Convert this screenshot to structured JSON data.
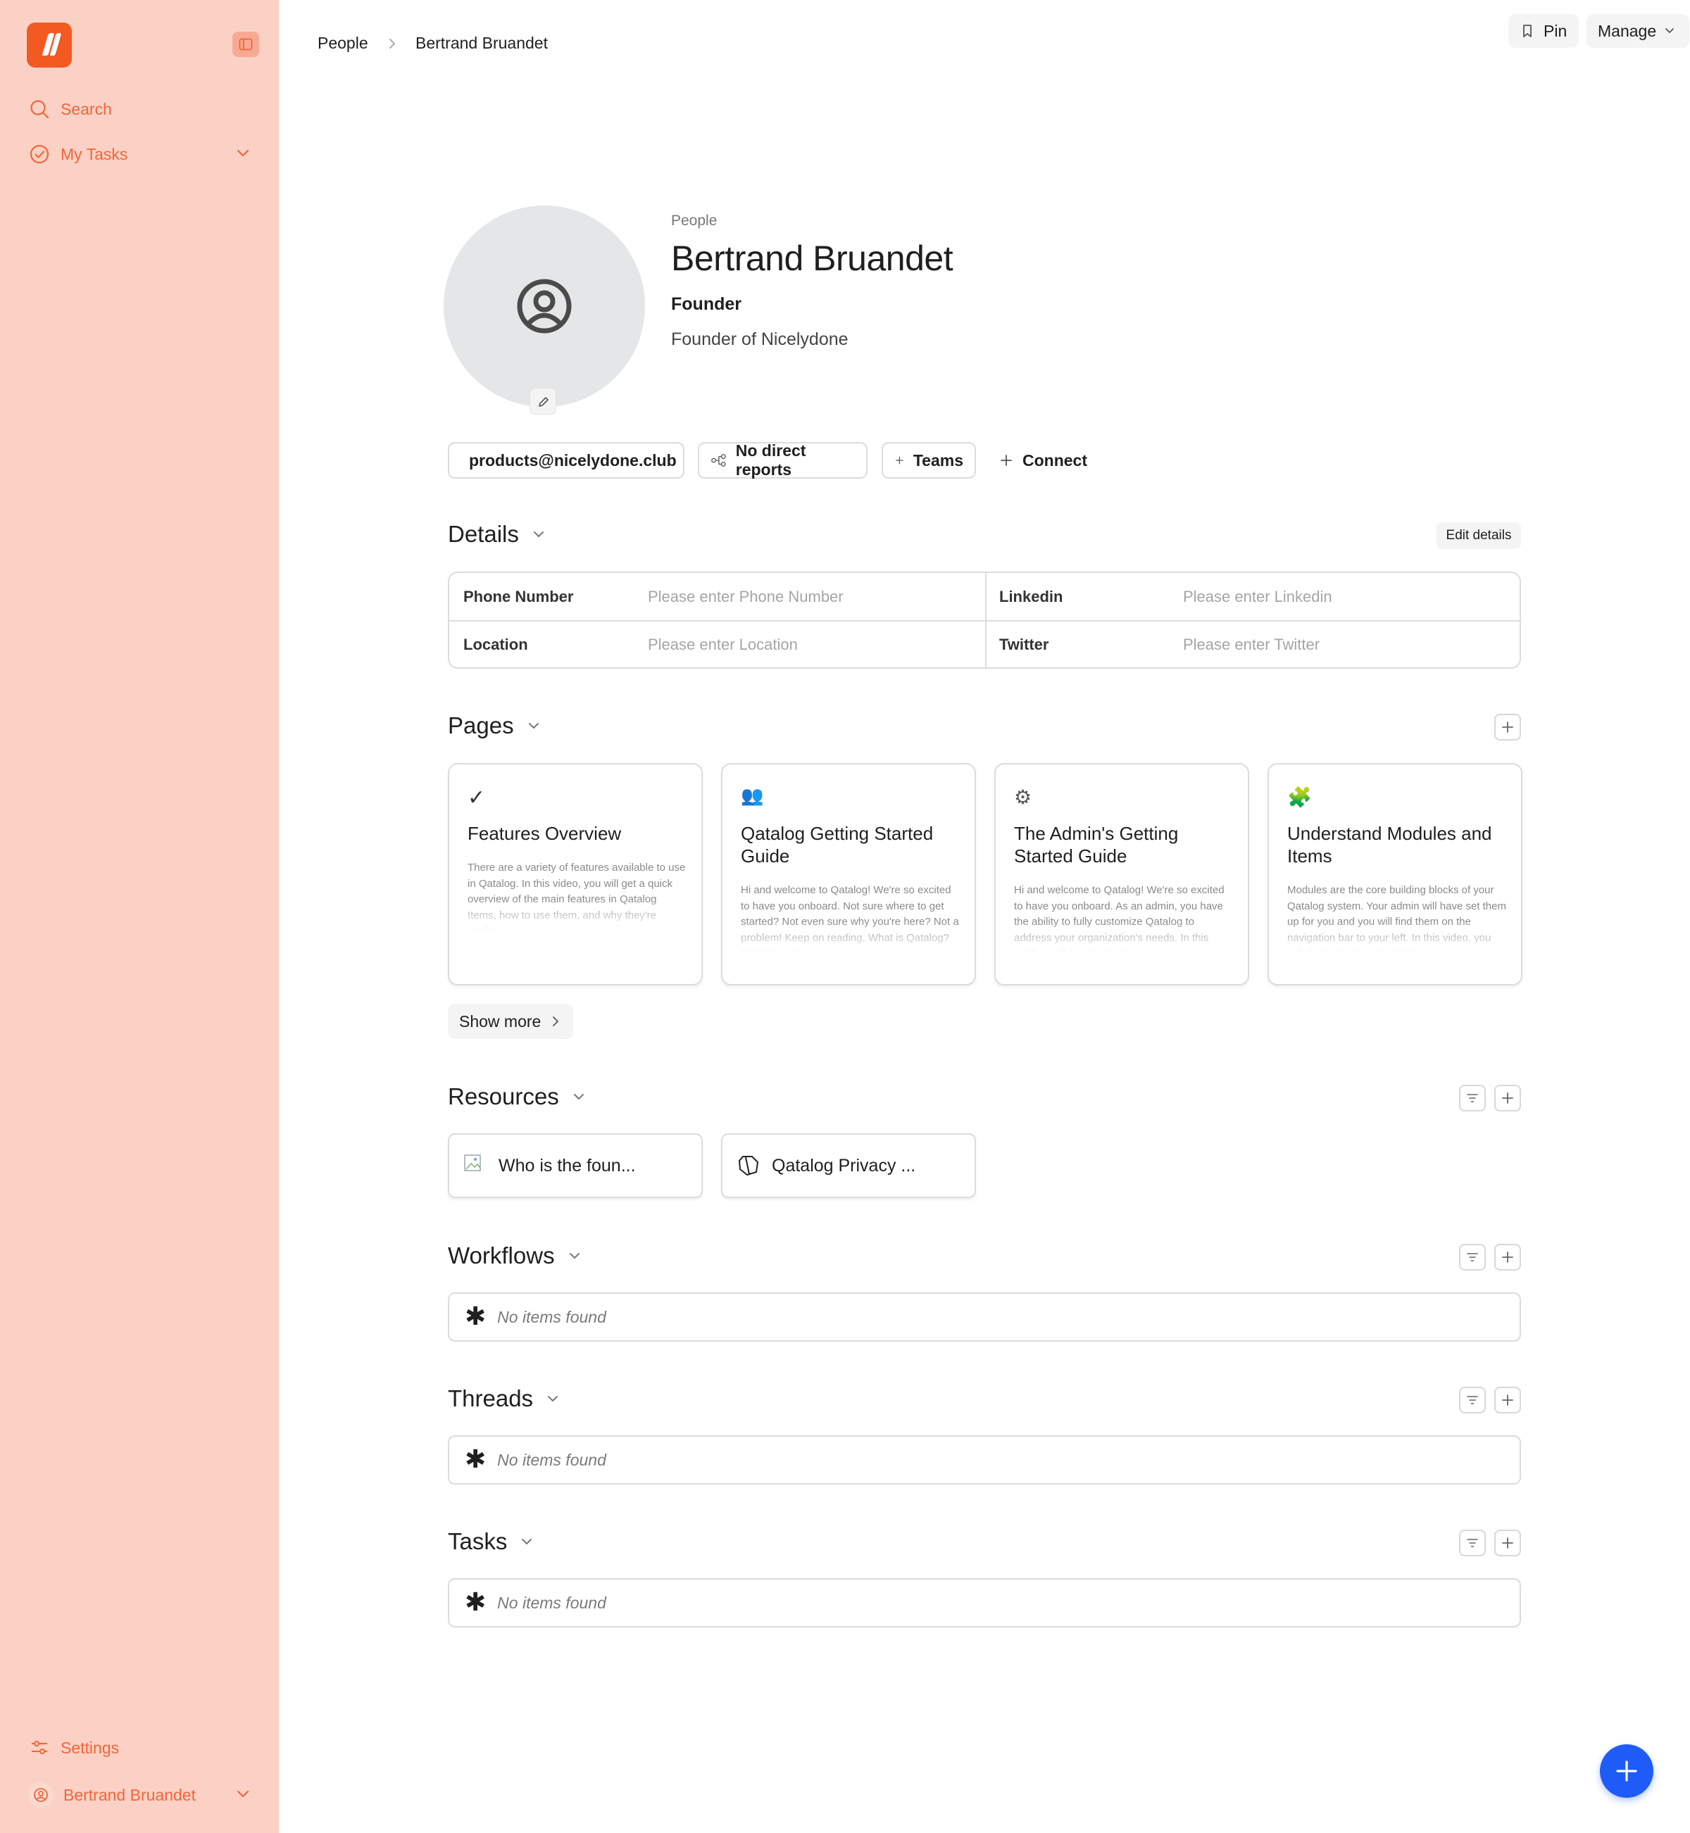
{
  "sidebar": {
    "search_label": "Search",
    "my_tasks_label": "My Tasks",
    "settings_label": "Settings",
    "user_label": "Bertrand Bruandet"
  },
  "breadcrumb": {
    "parent": "People",
    "current": "Bertrand Bruandet"
  },
  "toolbar": {
    "pin_label": "Pin",
    "manage_label": "Manage"
  },
  "profile": {
    "kicker": "People",
    "name": "Bertrand Bruandet",
    "role": "Founder",
    "bio": "Founder of Nicelydone"
  },
  "chips": {
    "email": "products@nicelydone.club",
    "reports": "No direct reports",
    "teams": "Teams",
    "connect": "Connect"
  },
  "details": {
    "title": "Details",
    "edit_label": "Edit details",
    "fields": [
      {
        "label": "Phone Number",
        "placeholder": "Please enter Phone Number"
      },
      {
        "label": "Linkedin",
        "placeholder": "Please enter Linkedin"
      },
      {
        "label": "Location",
        "placeholder": "Please enter Location"
      },
      {
        "label": "Twitter",
        "placeholder": "Please enter Twitter"
      }
    ]
  },
  "pages": {
    "title": "Pages",
    "show_more_label": "Show more",
    "cards": [
      {
        "icon": "✓",
        "title": "Features Overview",
        "desc": "There are a variety of features available to use in Qatalog. In this video, you will get a quick overview of the main features in Qatalog Items, how to use them, and why they're useful."
      },
      {
        "icon": "👥",
        "title": "Qatalog Getting Started Guide",
        "desc": "Hi and welcome to Qatalog! We're so excited to have you onboard. Not sure where to get started? Not even sure why you're here? Not a problem! Keep on reading. What is Qatalog? Qatalog is an..."
      },
      {
        "icon": "⚙",
        "title": "The Admin's Getting Started Guide",
        "desc": "Hi and welcome to Qatalog! We're so excited to have you onboard. As an admin, you have the ability to fully customize Qatalog to address your organization's needs. In this guide, we'll cover: How to..."
      },
      {
        "icon": "🧩",
        "title": "Understand Modules and Items",
        "desc": "Modules are the core building blocks of your Qatalog system. Your admin will have set them up for you and you will find them on the navigation bar to your left. In this video, you will discover more about how..."
      }
    ]
  },
  "resources": {
    "title": "Resources",
    "items": [
      {
        "label": "Who is the foun..."
      },
      {
        "label": "Qatalog Privacy ..."
      }
    ]
  },
  "workflows": {
    "title": "Workflows",
    "empty": "No items found"
  },
  "threads": {
    "title": "Threads",
    "empty": "No items found"
  },
  "tasks": {
    "title": "Tasks",
    "empty": "No items found"
  },
  "colors": {
    "sidebar_bg": "#fbd1c5",
    "accent": "#f0663a",
    "brand": "#f35a21",
    "fab": "#1f5cf7"
  }
}
